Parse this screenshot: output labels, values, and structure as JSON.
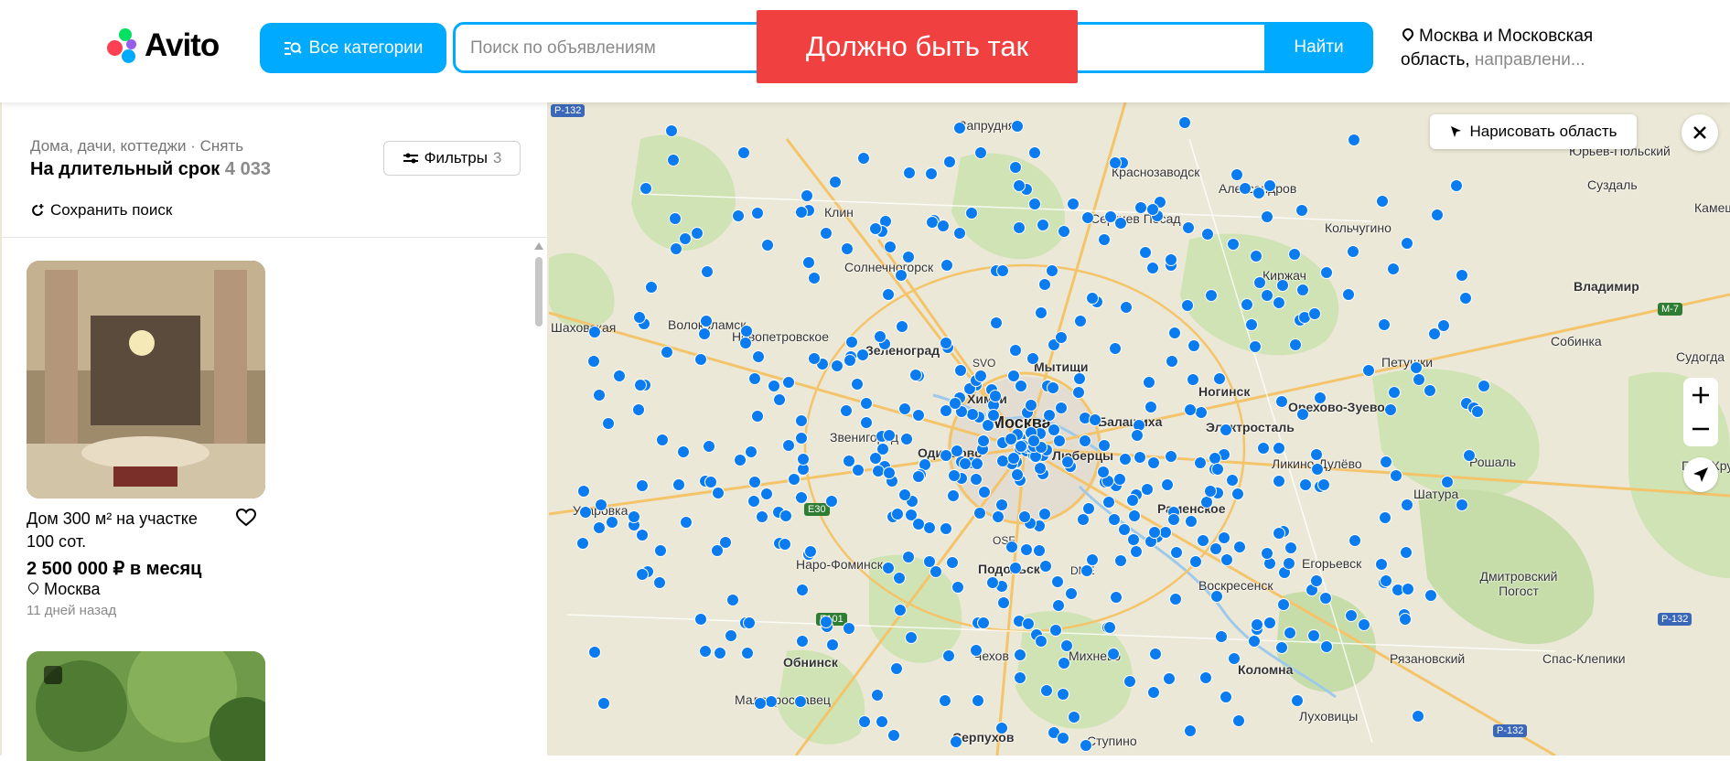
{
  "brand": {
    "name": "Avito"
  },
  "header": {
    "categories_button": "Все категории",
    "search_placeholder": "Поиск по объявлениям",
    "find_button": "Найти",
    "banner": "Должно быть так",
    "location_main": "Москва и Московская область,",
    "location_more": "направлени..."
  },
  "panel": {
    "breadcrumbs": "Дома, дачи, коттеджи · Снять",
    "title": "На длительный срок",
    "count": "4 033",
    "filters_label": "Фильтры",
    "filters_count": "3",
    "save_search": "Сохранить поиск"
  },
  "listing": {
    "title": "Дом 300 м² на участке 100 сот.",
    "price": "2 500 000 ₽ в месяц",
    "location": "Москва",
    "date": "11 дней назад"
  },
  "map": {
    "draw_area": "Нарисовать область",
    "labels": {
      "moskva": "Москва",
      "zaprudnya": "Запрудня",
      "krasnozavodsk": "Краснозаводск",
      "aleksandrov": "Александров",
      "yuryev": "Юрьев-Польский",
      "suzdal": "Суздаль",
      "kamesh": "Камеш",
      "sergiev": "Сергиев Посад",
      "klin": "Клин",
      "kolchugino": "Кольчугино",
      "kirzhach": "Киржач",
      "solnechnogorsk": "Солнечногорск",
      "vladimir": "Владимир",
      "volokolamsk": "Волоколамск",
      "novopetrovskoe": "Новопетровское",
      "sobinka": "Собинка",
      "petushki": "Петушки",
      "sudogda": "Судогда",
      "zelenograd": "Зеленоград",
      "khimki": "Химки",
      "mytishchi": "Мытищи",
      "noginsk": "Ногинск",
      "orekhovo": "Орехово-Зуево",
      "elektrostal": "Электросталь",
      "balashikha": "Балашиха",
      "zvenigorod": "Звенигород",
      "odintsovo": "Одинцово",
      "lyubertsy": "Люберцы",
      "likino": "Ликино-Дулёво",
      "roshal": "Рошаль",
      "gus": "Гусь-Хрустальный",
      "uvarovka": "Уваровка",
      "ramenskoe": "Раменское",
      "kurovskoe": "Шатура",
      "naro": "Наро-Фоминск",
      "podolsk": "Подольск",
      "voskresensk": "Воскресенск",
      "egoryevsk": "Егорьевск",
      "dmitrovsky": "Дмитровский Погост",
      "obninsk": "Обнинск",
      "chekhov": "Чехов",
      "mikhnevo": "Михнево",
      "kolomna": "Коломна",
      "ryazanovsky": "Рязановский",
      "spas": "Спас-Клепики",
      "maloyaroslavets": "Малоярославец",
      "serpukhov": "Серпухов",
      "stupino": "Ступино",
      "lukhovitsy": "Луховицы",
      "shakhovskaya": "Шаховская",
      "svo": "SVO",
      "osf": "OSF",
      "dme": "DME"
    },
    "roads": {
      "m7": "M-7",
      "e30": "E30",
      "e101": "E101",
      "p132a": "P-132",
      "p132b": "P-132",
      "p132c": "P-132"
    }
  },
  "colors": {
    "accent": "#00aaff",
    "banner": "#f04040",
    "marker": "#0a7cf0"
  },
  "icons": [
    "search-icon",
    "categories-icon",
    "location-pin-icon",
    "filters-icon",
    "save-search-icon",
    "heart-icon",
    "close-icon",
    "zoom-in-icon",
    "zoom-out-icon",
    "geolocation-icon",
    "draw-cursor-icon",
    "gallery-icon"
  ]
}
